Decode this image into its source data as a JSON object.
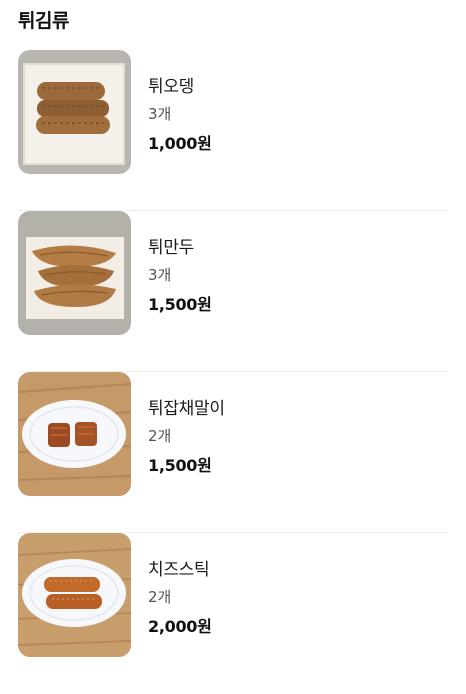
{
  "section": {
    "title": "튀김류"
  },
  "items": [
    {
      "name": "튀오뎅",
      "qty": "3개",
      "price": "1,000원",
      "image": "fried-fishcake-photo"
    },
    {
      "name": "튀만두",
      "qty": "3개",
      "price": "1,500원",
      "image": "fried-dumpling-photo"
    },
    {
      "name": "튀잡채말이",
      "qty": "2개",
      "price": "1,500원",
      "image": "fried-japchae-roll-photo"
    },
    {
      "name": "치즈스틱",
      "qty": "2개",
      "price": "2,000원",
      "image": "cheese-stick-photo"
    }
  ],
  "colors": {
    "text": "#1a1a1a",
    "muted": "#555555",
    "divider": "#efefef"
  }
}
